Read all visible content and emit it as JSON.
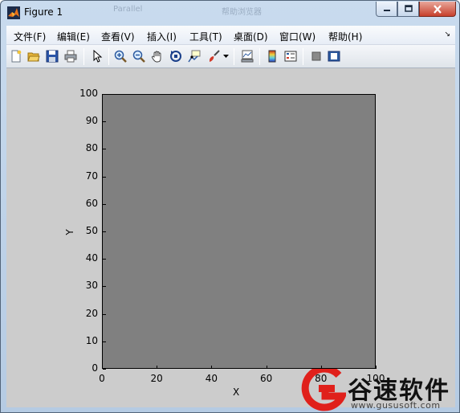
{
  "window": {
    "title": "Figure 1",
    "background_tabs": [
      "Parallel",
      "帮助浏览器"
    ]
  },
  "menu": {
    "items": [
      {
        "label": "文件(F)"
      },
      {
        "label": "编辑(E)"
      },
      {
        "label": "查看(V)"
      },
      {
        "label": "插入(I)"
      },
      {
        "label": "工具(T)"
      },
      {
        "label": "桌面(D)"
      },
      {
        "label": "窗口(W)"
      },
      {
        "label": "帮助(H)"
      }
    ]
  },
  "toolbar": {
    "buttons": [
      "new-figure-icon",
      "open-file-icon",
      "save-icon",
      "print-icon",
      "edit-plot-arrow-icon",
      "zoom-in-icon",
      "zoom-out-icon",
      "pan-hand-icon",
      "rotate-3d-icon",
      "data-cursor-icon",
      "brush-icon",
      "brush-dropdown-icon",
      "link-plot-icon",
      "insert-colorbar-icon",
      "insert-legend-icon",
      "hide-plot-tools-icon",
      "show-plot-tools-icon"
    ]
  },
  "chart_data": {
    "type": "scatter",
    "title": "",
    "xlabel": "X",
    "ylabel": "Y",
    "xlim": [
      0,
      100
    ],
    "ylim": [
      0,
      100
    ],
    "xticks": [
      "0",
      "20",
      "40",
      "60",
      "80",
      "100"
    ],
    "yticks": [
      "0",
      "10",
      "20",
      "30",
      "40",
      "50",
      "60",
      "70",
      "80",
      "90",
      "100"
    ],
    "series": [],
    "axes_background": "#808080",
    "figure_background": "#cccccc",
    "grid": false
  },
  "watermark": {
    "text": "谷速软件",
    "url": "www.gususoft.com",
    "logo_color": "#e0201b"
  }
}
